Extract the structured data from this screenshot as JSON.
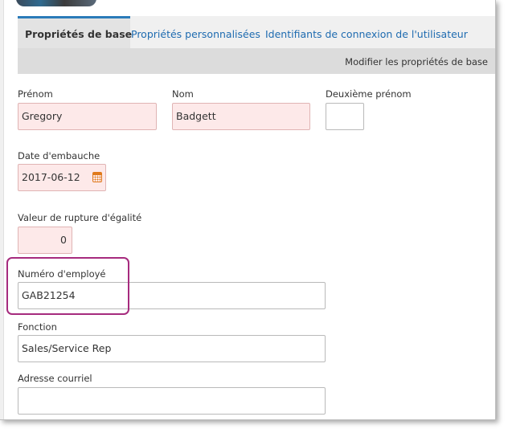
{
  "tabs": [
    {
      "label": "Propriétés de base",
      "active": true
    },
    {
      "label": "Propriétés personnalisées",
      "active": false
    },
    {
      "label": "Identifiants de connexion de l'utilisateur",
      "active": false
    }
  ],
  "toolbar": {
    "edit_label": "Modifier les propriétés de base"
  },
  "form": {
    "first_name": {
      "label": "Prénom",
      "value": "Gregory"
    },
    "last_name": {
      "label": "Nom",
      "value": "Badgett"
    },
    "middle_name": {
      "label": "Deuxième prénom",
      "value": ""
    },
    "hire_date": {
      "label": "Date d'embauche",
      "value": "2017-06-12"
    },
    "tiebreak": {
      "label": "Valeur de rupture d'égalité",
      "value": "0"
    },
    "employee_number": {
      "label": "Numéro d'employé",
      "value": "GAB21254"
    },
    "job_title": {
      "label": "Fonction",
      "value": "Sales/Service Rep"
    },
    "email": {
      "label": "Adresse courriel",
      "value": ""
    }
  },
  "colors": {
    "accent": "#2b7bb9",
    "link": "#1e6bb0",
    "required_bg": "#fde9e9",
    "highlight": "#a62b7e",
    "calendar_icon": "#e07a1c"
  },
  "icons": {
    "date_picker": "calendar-icon"
  }
}
